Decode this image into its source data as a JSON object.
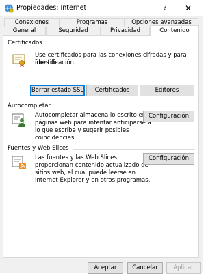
{
  "window": {
    "title": "Propiedades: Internet",
    "help_label": "?",
    "close_label": "✕"
  },
  "tabs": {
    "row1": [
      {
        "label": "Conexiones"
      },
      {
        "label": "Programas"
      },
      {
        "label": "Opciones avanzadas"
      }
    ],
    "row2": [
      {
        "label": "General"
      },
      {
        "label": "Seguridad"
      },
      {
        "label": "Privacidad"
      },
      {
        "label": "Contenido"
      }
    ],
    "active": "Contenido"
  },
  "certificates": {
    "title": "Certificados",
    "desc1": "Use certificados para las conexiones cifradas y para fines de",
    "desc2": "identificación.",
    "buttons": [
      "Borrar estado SSL",
      "Certificados",
      "Editores"
    ],
    "icon": "certificate-icon"
  },
  "autocomplete": {
    "title": "Autocompletar",
    "desc1": "Autocompletar almacena lo escrito en",
    "desc2": "páginas web para intentar anticiparse a",
    "desc3": "lo que escribe y sugerir posibles",
    "desc4": "coincidencias.",
    "button": "Configuración",
    "icon": "autocomplete-icon"
  },
  "feeds": {
    "title": "Fuentes y Web Slices",
    "desc1": "Las fuentes y las Web Slices",
    "desc2": "proporcionan contenido actualizado de",
    "desc3": "sitios web, el cual puede leerse en",
    "desc4": "Internet Explorer y en otros programas.",
    "button": "Configuración",
    "icon": "feeds-icon"
  },
  "footer": {
    "ok": "Aceptar",
    "cancel": "Cancelar",
    "apply": "Aplicar"
  },
  "colors": {
    "accent": "#0078d7",
    "panel_bg": "#ffffff",
    "dialog_bg": "#f0f0f0"
  }
}
